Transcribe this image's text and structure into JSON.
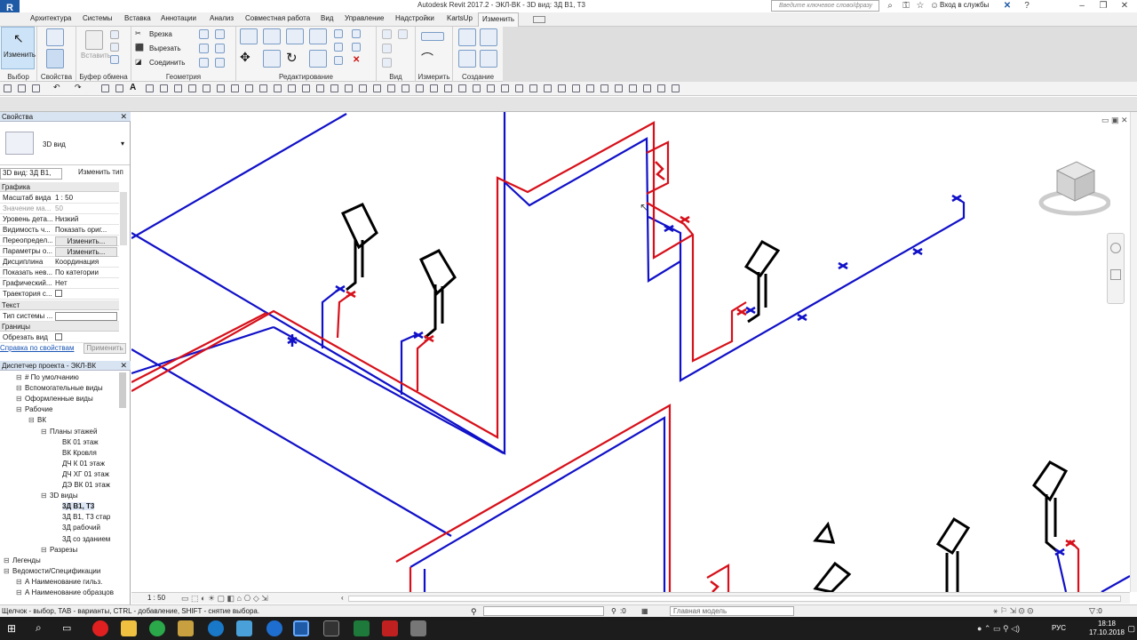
{
  "titlebar": {
    "app_title": "Autodesk Revit 2017.2 -    ЭКЛ-ВК - 3D вид: 3Д В1, Т3",
    "search_placeholder": "Введите ключевое слово/фразу",
    "signin": "Вход в службы"
  },
  "menu_tabs": [
    "Архитектура",
    "Системы",
    "Вставка",
    "Аннотации",
    "Анализ",
    "Совместная работа",
    "Вид",
    "Управление",
    "Надстройки",
    "KartsUp",
    "Изменить"
  ],
  "active_tab": "Изменить",
  "ribbon": {
    "modify_label": "Изменить",
    "select_label": "Выбор",
    "properties_label": "Свойства",
    "clipboard_label": "Буфер обмена",
    "paste_label": "Вставить",
    "geometry_label": "Геометрия",
    "cut_label": "Врезка",
    "cutout_label": "Вырезать",
    "join_label": "Соединить",
    "editing_label": "Редактирование",
    "view_label": "Вид",
    "measure_label": "Измерить",
    "create_label": "Создание"
  },
  "properties": {
    "header": "Свойства",
    "type_name": "3D вид",
    "instance_selector": "3D вид: 3Д В1,",
    "edit_type": "Изменить тип",
    "cat_graphics": "Графика",
    "rows": [
      {
        "label": "Масштаб вида",
        "value": "1 : 50"
      },
      {
        "label": "Значение ма...",
        "value": "50"
      },
      {
        "label": "Уровень дета...",
        "value": "Низкий"
      },
      {
        "label": "Видимость ч...",
        "value": "Показать ориг..."
      },
      {
        "label": "Переопредел...",
        "value": "Изменить..."
      },
      {
        "label": "Параметры о...",
        "value": "Изменить..."
      },
      {
        "label": "Дисциплина",
        "value": "Координация"
      },
      {
        "label": "Показать нев...",
        "value": "По категории"
      },
      {
        "label": "Графический...",
        "value": "Нет"
      },
      {
        "label": "Траектория с...",
        "value": ""
      }
    ],
    "cat_text": "Текст",
    "system_type_label": "Тип системы ...",
    "cat_bounds": "Границы",
    "crop_label": "Обрезать вид",
    "help_link": "Справка по свойствам",
    "apply": "Применить"
  },
  "browser": {
    "header": "Диспетчер проекта - ЭКЛ-ВК",
    "items": [
      {
        "text": "# По умолчанию",
        "level": 1
      },
      {
        "text": "Вспомогательные виды",
        "level": 1
      },
      {
        "text": "Оформленные виды",
        "level": 1
      },
      {
        "text": "Рабочие",
        "level": 1
      },
      {
        "text": "ВК",
        "level": 2
      },
      {
        "text": "Планы этажей",
        "level": 3
      },
      {
        "text": "ВК 01 этаж",
        "level": 4
      },
      {
        "text": "ВК Кровля",
        "level": 4
      },
      {
        "text": "ДЧ К 01 этаж",
        "level": 4
      },
      {
        "text": "ДЧ ХГ 01 этаж",
        "level": 4
      },
      {
        "text": "ДЭ ВК 01 этаж",
        "level": 4
      },
      {
        "text": "3D виды",
        "level": 3
      },
      {
        "text": "3Д В1, Т3",
        "level": 4,
        "selected": true
      },
      {
        "text": "3Д В1, Т3 стар",
        "level": 4
      },
      {
        "text": "3Д рабочий",
        "level": 4
      },
      {
        "text": "3Д со зданием",
        "level": 4
      },
      {
        "text": "Разрезы",
        "level": 3
      },
      {
        "text": "Легенды",
        "level": 0
      },
      {
        "text": "Ведомости/Спецификации",
        "level": 0
      },
      {
        "text": "А Наименование гильз.",
        "level": 1
      },
      {
        "text": "А Наименование образцов",
        "level": 1
      }
    ]
  },
  "viewbar": {
    "scale": "1 : 50"
  },
  "status": {
    "hint": "Щелчок - выбор, TAB - варианты, CTRL - добавление, SHIFT - снятие выбора.",
    "coord": ":0",
    "model": "Главная модель",
    "filter": ":0"
  },
  "taskbar": {
    "lang": "РУС",
    "time": "18:18",
    "date": "17.10.2018"
  },
  "colors": {
    "supply": "#d6101a",
    "return": "#1010c8",
    "fixture": "#000000",
    "accent": "#1f5aa6"
  }
}
